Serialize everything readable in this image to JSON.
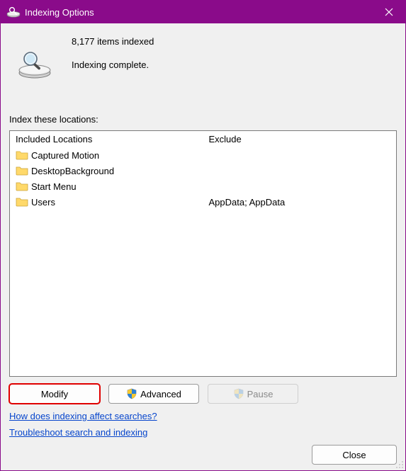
{
  "titlebar": {
    "title": "Indexing Options"
  },
  "status": {
    "count_text": "8,177 items indexed",
    "state_text": "Indexing complete."
  },
  "locations_label": "Index these locations:",
  "headers": {
    "included": "Included Locations",
    "exclude": "Exclude"
  },
  "rows": [
    {
      "name": "Captured Motion",
      "exclude": ""
    },
    {
      "name": "DesktopBackground",
      "exclude": ""
    },
    {
      "name": "Start Menu",
      "exclude": ""
    },
    {
      "name": "Users",
      "exclude": "AppData; AppData"
    }
  ],
  "buttons": {
    "modify": "Modify",
    "advanced": "Advanced",
    "pause": "Pause",
    "close": "Close"
  },
  "links": {
    "help": "How does indexing affect searches?",
    "troubleshoot": "Troubleshoot search and indexing"
  }
}
